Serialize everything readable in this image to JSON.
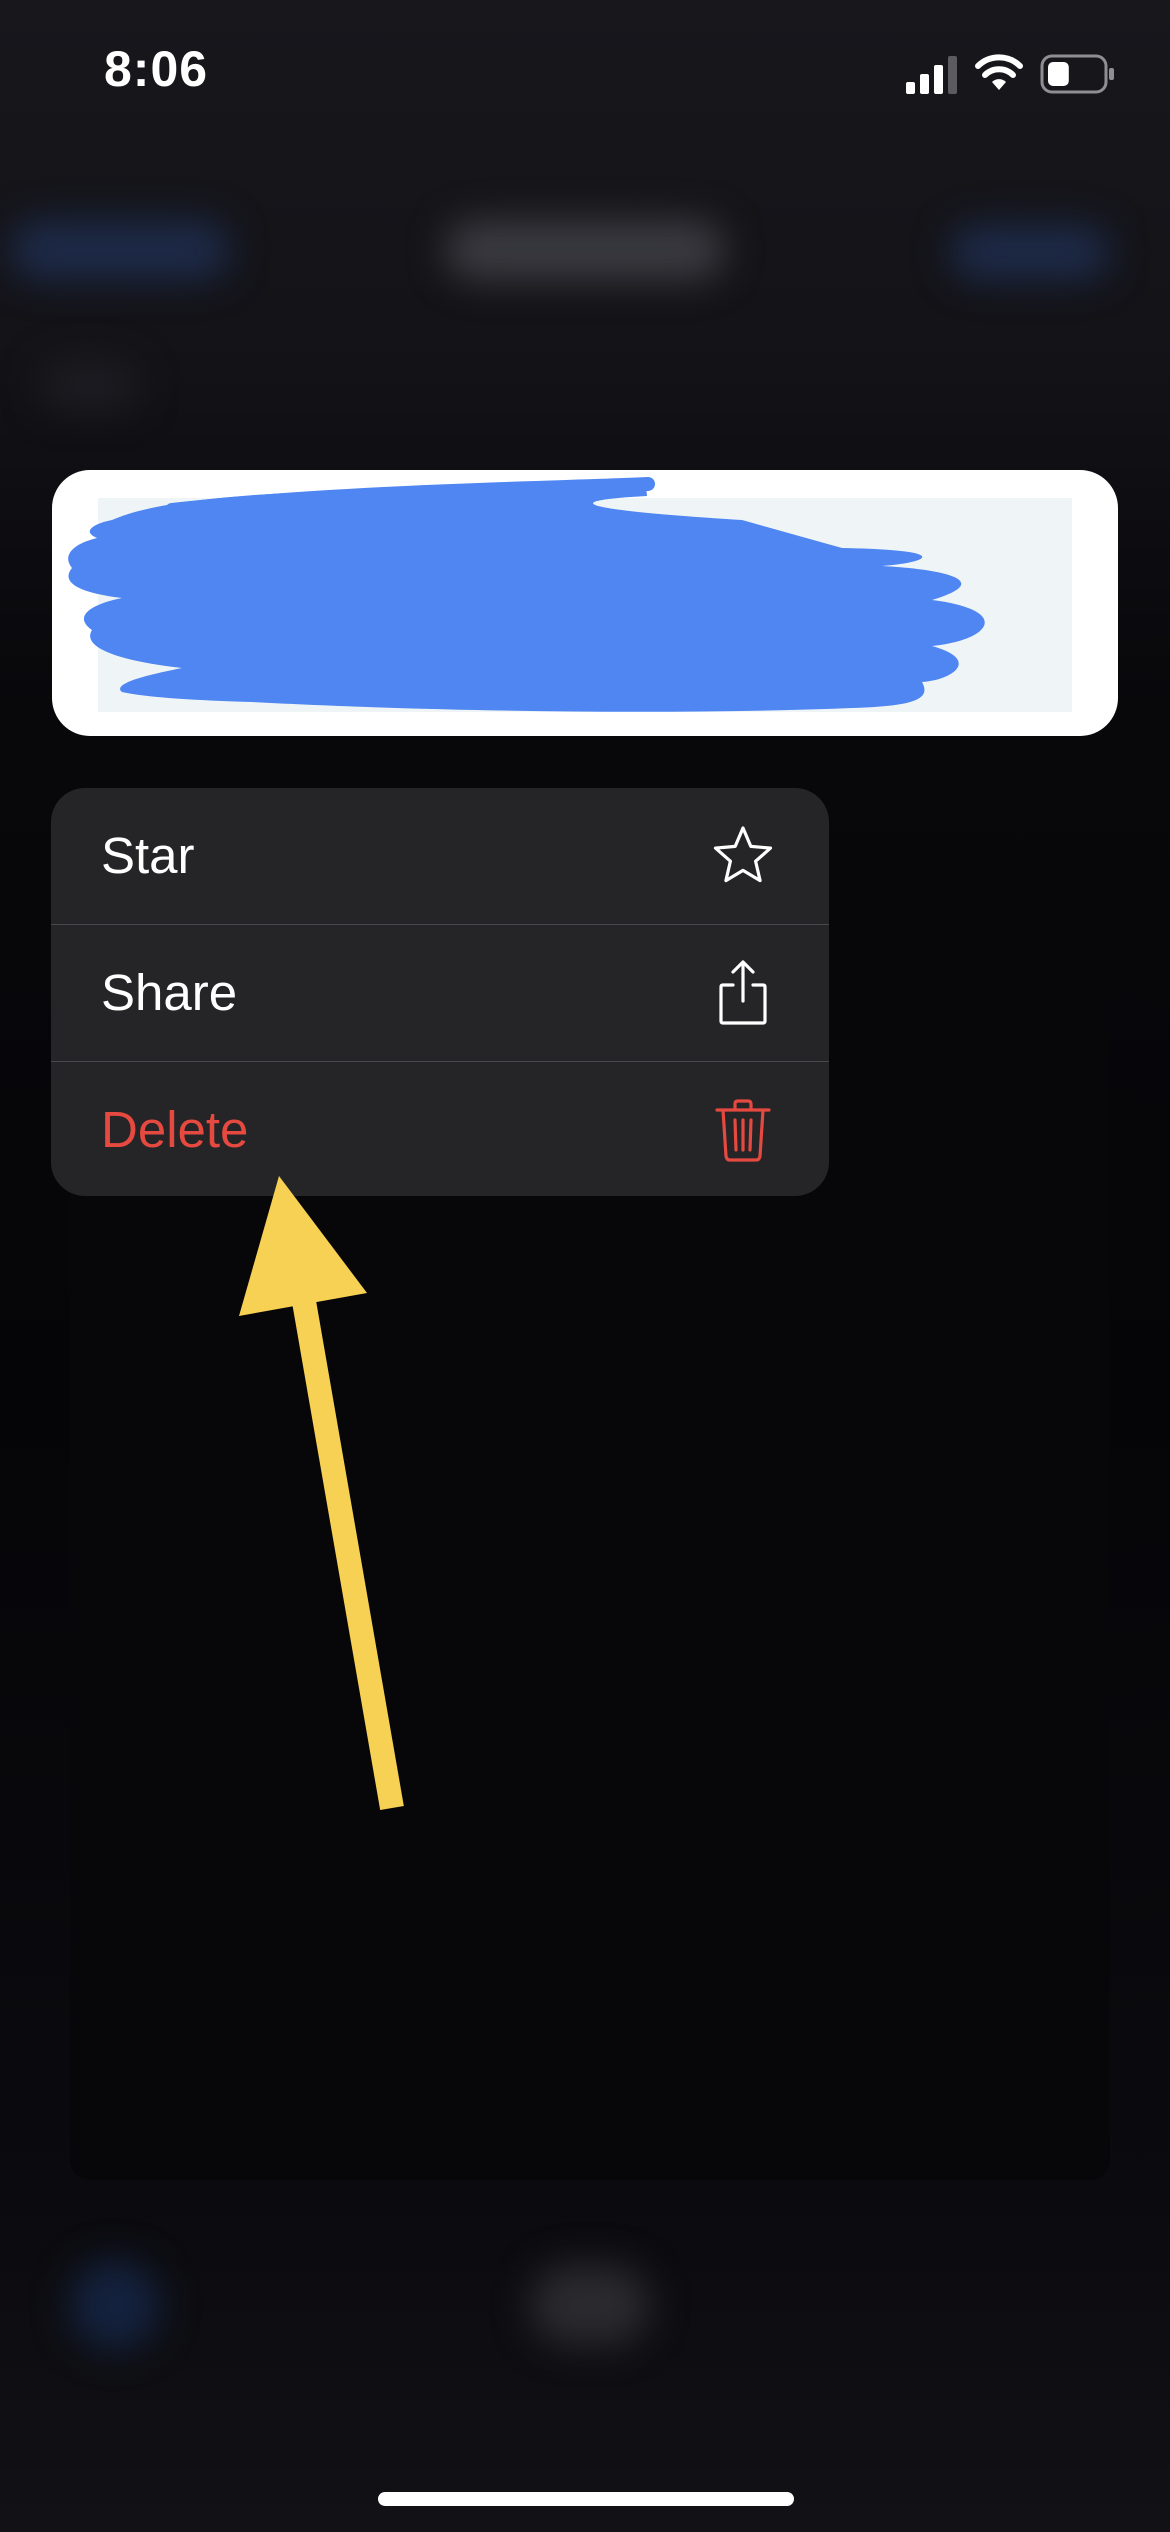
{
  "status_bar": {
    "time": "8:06",
    "signal_icon": "cellular-signal-icon",
    "wifi_icon": "wifi-icon",
    "battery_icon": "battery-icon",
    "battery_level": 0.4
  },
  "preview": {
    "redacted": true,
    "redaction_color": "#4f86f2"
  },
  "context_menu": {
    "items": [
      {
        "label": "Star",
        "icon": "star-icon",
        "destructive": false
      },
      {
        "label": "Share",
        "icon": "share-icon",
        "destructive": false
      },
      {
        "label": "Delete",
        "icon": "trash-icon",
        "destructive": true
      }
    ]
  },
  "annotation": {
    "type": "arrow",
    "color": "#f7d154",
    "points_to": "Delete"
  },
  "colors": {
    "menu_background": "#252527",
    "destructive": "#e5493f",
    "background": "#050508"
  }
}
